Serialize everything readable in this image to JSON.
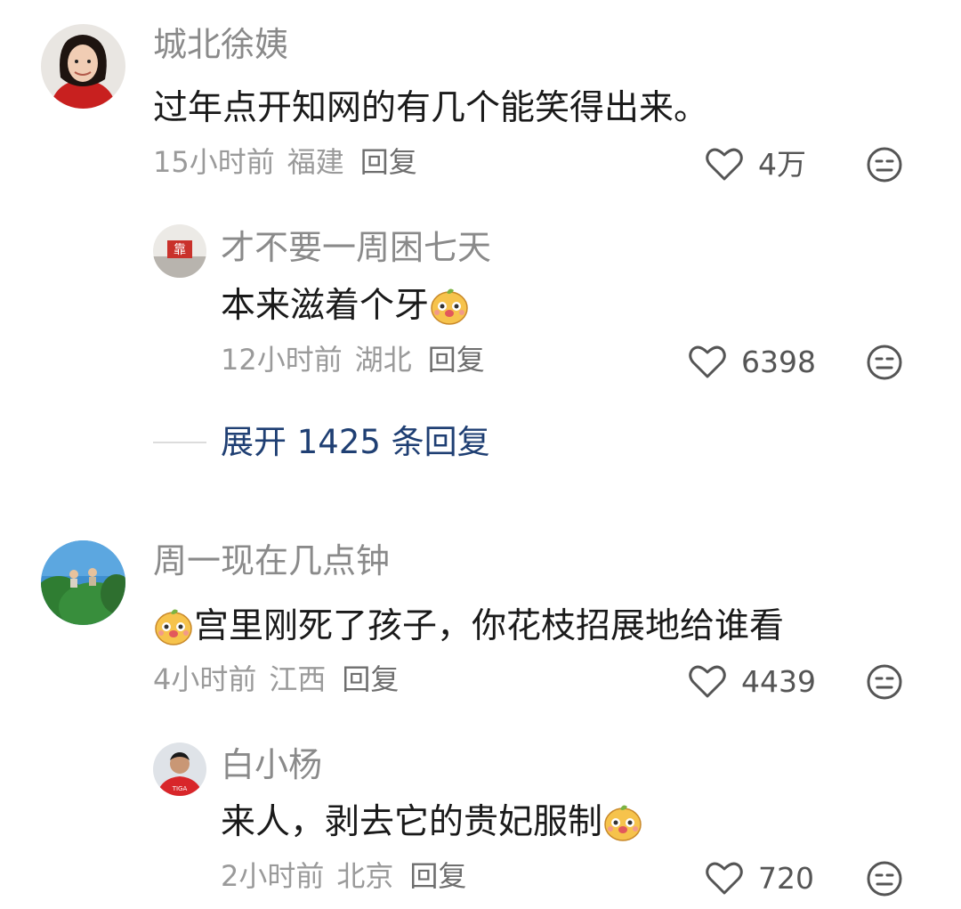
{
  "comments": [
    {
      "user": "城北徐姨",
      "text": "过年点开知网的有几个能笑得出来。",
      "time": "15小时前",
      "location": "福建",
      "reply_label": "回复",
      "likes": "4万",
      "avatar": "avatar-woman-red-scarf",
      "replies": [
        {
          "user": "才不要一周困七天",
          "text": "本来滋着个牙",
          "emoji": "dog-face-emoji",
          "time": "12小时前",
          "location": "湖北",
          "reply_label": "回复",
          "likes": "6398",
          "avatar": "avatar-red-sign-building"
        }
      ],
      "expand_label": "展开 1425 条回复"
    },
    {
      "user": "周一现在几点钟",
      "text": "宫里刚死了孩子，你花枝招展地给谁看",
      "emoji": "dog-face-emoji",
      "time": "4小时前",
      "location": "江西",
      "reply_label": "回复",
      "likes": "4439",
      "avatar": "avatar-people-in-trees",
      "replies": [
        {
          "user": "白小杨",
          "text": "来人，剥去它的贵妃服制",
          "emoji": "dog-face-emoji",
          "time": "2小时前",
          "location": "北京",
          "reply_label": "回复",
          "likes": "720",
          "avatar": "avatar-man-red-shirt"
        }
      ]
    }
  ],
  "icons": {
    "like": "heart-outline-icon",
    "dislike": "meh-face-icon"
  },
  "colors": {
    "expand_link": "#1f3f73",
    "meta": "#9a9a9a",
    "name": "#8a8a8a"
  }
}
